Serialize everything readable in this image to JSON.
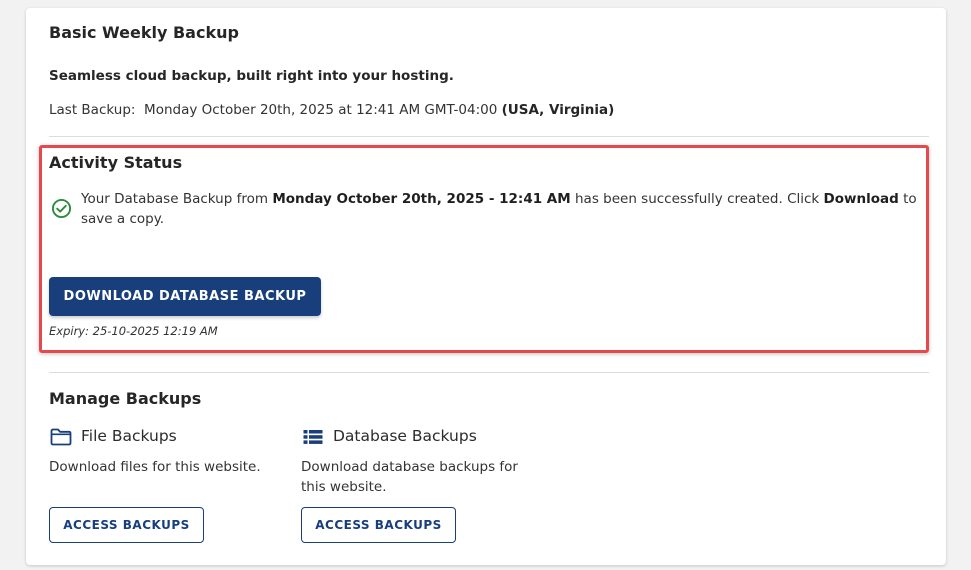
{
  "colors": {
    "primary": "#183e7c",
    "highlight_border": "#e5484d",
    "success": "#2e8b3e"
  },
  "card": {
    "title": "Basic Weekly Backup",
    "tagline": "Seamless cloud backup, built right into your hosting.",
    "last_backup_label": "Last Backup:",
    "last_backup_value": "Monday October 20th, 2025 at 12:41 AM GMT-04:00",
    "last_backup_region": "(USA, Virginia)"
  },
  "activity": {
    "title": "Activity Status",
    "status_icon": "check-circle-icon",
    "msg_prefix": "Your Database Backup from",
    "msg_date": "Monday October 20th, 2025 - 12:41 AM",
    "msg_middle": "has been successfully created. Click",
    "msg_action": "Download",
    "msg_suffix": "to save a copy.",
    "download_button": "DOWNLOAD DATABASE BACKUP",
    "expiry": "Expiry: 25-10-2025 12:19 AM"
  },
  "manage": {
    "title": "Manage Backups",
    "file": {
      "icon": "folder-icon",
      "title": "File Backups",
      "description": "Download files for this website.",
      "button": "ACCESS BACKUPS"
    },
    "database": {
      "icon": "database-list-icon",
      "title": "Database Backups",
      "description": "Download database backups for this website.",
      "button": "ACCESS BACKUPS"
    }
  }
}
